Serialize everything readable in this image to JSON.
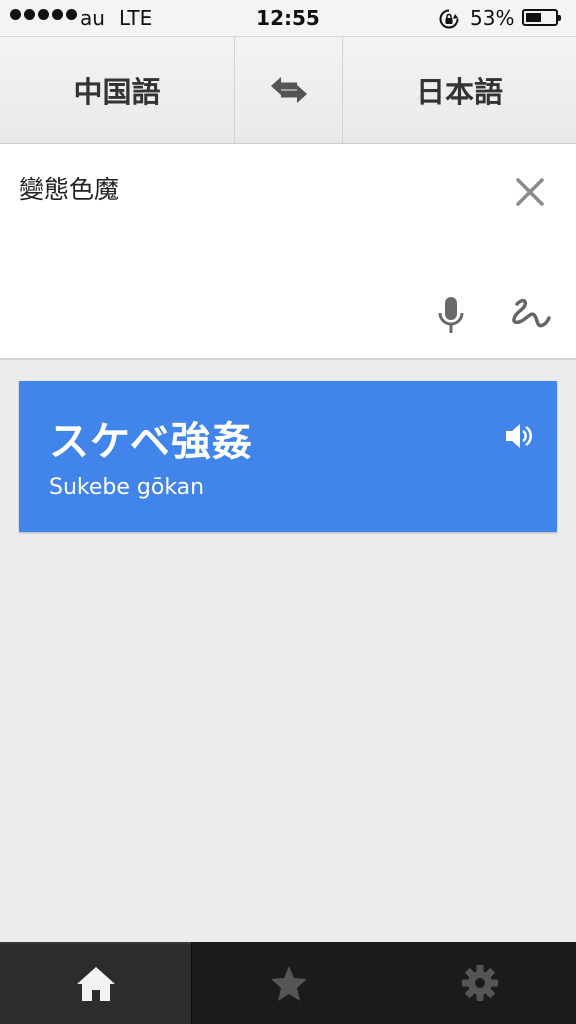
{
  "status_bar": {
    "carrier": "au",
    "network": "LTE",
    "time": "12:55",
    "battery_percent": "53%",
    "battery_level": 0.53
  },
  "language_bar": {
    "source_language": "中国語",
    "target_language": "日本語",
    "swap_icon": "swap-arrows-icon"
  },
  "input": {
    "text": "變態色魔",
    "clear_icon": "close-icon",
    "mic_icon": "microphone-icon",
    "handwriting_icon": "handwriting-icon"
  },
  "result": {
    "translation": "スケベ強姦",
    "transliteration": "Sukebe gōkan",
    "speaker_icon": "speaker-icon",
    "card_color": "#4285ea"
  },
  "bottom_nav": {
    "items": [
      {
        "name": "home",
        "icon": "home-icon",
        "active": true
      },
      {
        "name": "favorites",
        "icon": "star-icon",
        "active": false
      },
      {
        "name": "settings",
        "icon": "gear-icon",
        "active": false
      }
    ]
  }
}
